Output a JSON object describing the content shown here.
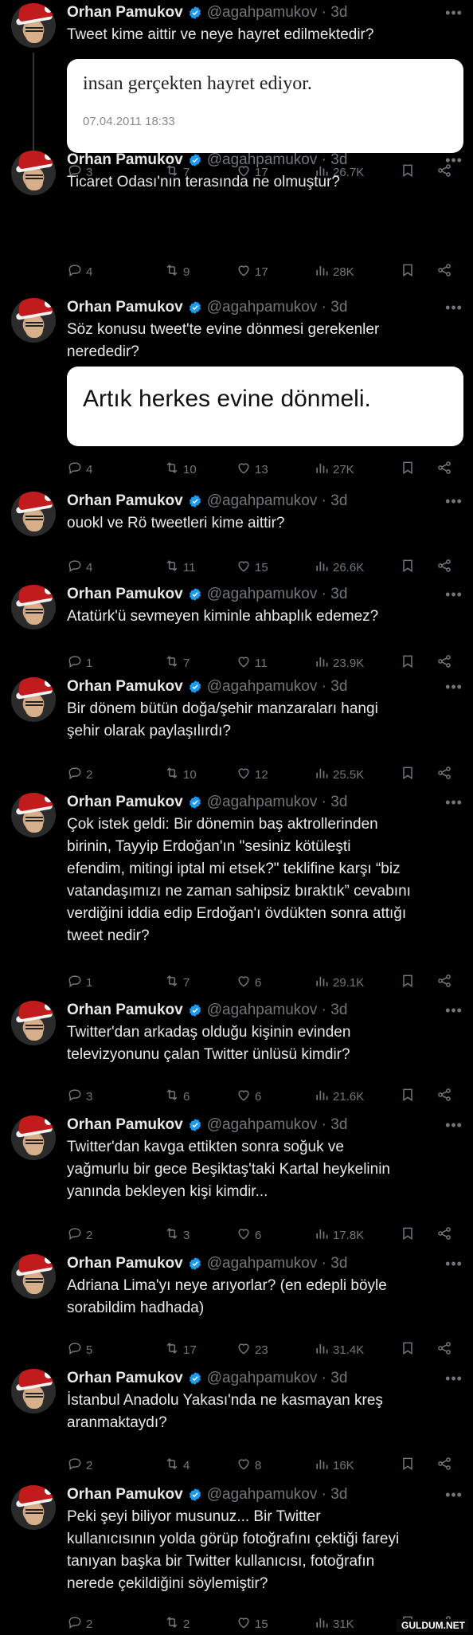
{
  "author": {
    "name": "Orhan Pamukov",
    "handle": "@agahpamukov · 3d"
  },
  "tweets": [
    {
      "text": "Tweet kime aittir ve neye hayret edilmektedir?",
      "embed": {
        "title": "insan gerçekten hayret ediyor.",
        "date": "07.04.2011 18:33"
      },
      "reply": "3",
      "retweet": "7",
      "like": "17",
      "views": "26.7K"
    },
    {
      "text": "Ticaret Odası'nın terasında ne olmuştur?",
      "reply": "4",
      "retweet": "9",
      "like": "17",
      "views": "28K"
    },
    {
      "text": "Söz konusu tweet'te evine dönmesi gerekenler\nnerededir?",
      "embed": {
        "title": "Artık herkes evine dönmeli."
      },
      "reply": "4",
      "retweet": "10",
      "like": "13",
      "views": "27K"
    },
    {
      "text": "ouokl ve Rö tweetleri kime aittir?",
      "reply": "4",
      "retweet": "11",
      "like": "15",
      "views": "26.6K"
    },
    {
      "text": "Atatürk'ü sevmeyen kiminle ahbaplık edemez?",
      "reply": "1",
      "retweet": "7",
      "like": "11",
      "views": "23.9K"
    },
    {
      "text": "Bir dönem bütün doğa/şehir manzaraları hangi\nşehir olarak paylaşılırdı?",
      "reply": "2",
      "retweet": "10",
      "like": "12",
      "views": "25.5K"
    },
    {
      "text": "Çok istek geldi: Bir dönemin baş aktrollerinden\nbirinin, Tayyip Erdoğan'ın \"sesiniz kötüleşti\nefendim, mitingi iptal mi etsek?\" teklifine karşı “biz\nvatandaşımızı ne zaman sahipsiz bıraktık” cevabını\nverdiğini iddia edip Erdoğan'ı övdükten sonra attığı\ntweet nedir?",
      "reply": "1",
      "retweet": "7",
      "like": "6",
      "views": "29.1K"
    },
    {
      "text": "Twitter'dan arkadaş olduğu kişinin evinden\ntelevizyonunu çalan Twitter ünlüsü kimdir?",
      "reply": "3",
      "retweet": "6",
      "like": "6",
      "views": "21.6K"
    },
    {
      "text": "Twitter'dan kavga ettikten sonra soğuk ve\nyağmurlu bir gece Beşiktaş'taki Kartal heykelinin\nyanında bekleyen kişi kimdir...",
      "reply": "2",
      "retweet": "3",
      "like": "6",
      "views": "17.8K"
    },
    {
      "text": "Adriana Lima'yı neye arıyorlar? (en edepli böyle\nsorabildim hadhada)",
      "reply": "5",
      "retweet": "17",
      "like": "23",
      "views": "31.4K"
    },
    {
      "text": "İstanbul Anadolu Yakası'nda ne kasmayan kreş\naranmaktaydı?",
      "reply": "2",
      "retweet": "4",
      "like": "8",
      "views": "16K"
    },
    {
      "text": "Peki şeyi biliyor musunuz... Bir Twitter\nkullanıcısının yolda görüp fotoğrafını çektiği fareyi\ntanıyan başka bir Twitter kullanıcısı, fotoğrafın\nnerede çekildiğini söylemiştir?",
      "reply": "2",
      "retweet": "2",
      "like": "15",
      "views": "31K"
    }
  ],
  "watermark": "GULDUM.NET",
  "colors": {
    "background": "#000000",
    "text": "#e7e9ea",
    "muted": "#71767b",
    "verified": "#1d9bf0"
  }
}
